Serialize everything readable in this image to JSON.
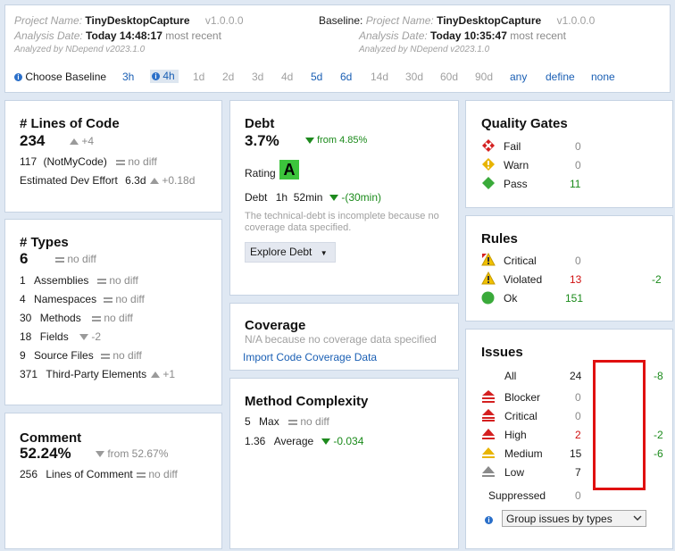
{
  "header": {
    "project_label": "Project Name:",
    "project_name": "TinyDesktopCapture",
    "version": "v1.0.0.0",
    "analysis_label": "Analysis Date:",
    "analysis_date": "Today 14:48:17",
    "most_recent": "most recent",
    "analyzed_by": "Analyzed by NDepend v2023.1.0",
    "baseline_label": "Baseline:",
    "baseline_project_label": "Project Name:",
    "baseline_project_name": "TinyDesktopCapture",
    "baseline_version": "v1.0.0.0",
    "baseline_analysis_label": "Analysis Date:",
    "baseline_analysis_date": "Today 10:35:47",
    "baseline_most_recent": "most recent",
    "baseline_analyzed_by": "Analyzed by NDepend v2023.1.0"
  },
  "baseline_bar": {
    "choose_label": "Choose Baseline",
    "options": [
      "3h",
      "4h",
      "1d",
      "2d",
      "3d",
      "4d",
      "5d",
      "6d",
      "14d",
      "30d",
      "60d",
      "90d",
      "any",
      "define",
      "none"
    ],
    "selected": "4h"
  },
  "loc": {
    "title": "# Lines of Code",
    "value": "234",
    "delta": "+4",
    "notmycode_value": "117",
    "notmycode_label": "(NotMyCode)",
    "notmycode_diff": "no diff",
    "effort_label": "Estimated Dev Effort",
    "effort_value": "6.3d",
    "effort_delta": "+0.18d"
  },
  "types": {
    "title": "# Types",
    "value": "6",
    "diff": "no diff",
    "rows": [
      {
        "value": "1",
        "label": "Assemblies",
        "diff": "no diff"
      },
      {
        "value": "4",
        "label": "Namespaces",
        "diff": "no diff"
      },
      {
        "value": "30",
        "label": "Methods",
        "diff": "no diff"
      },
      {
        "value": "18",
        "label": "Fields",
        "diff": "-2"
      },
      {
        "value": "9",
        "label": "Source Files",
        "diff": "no diff"
      },
      {
        "value": "371",
        "label": "Third-Party Elements",
        "diff": "+1"
      }
    ]
  },
  "comment": {
    "title": "Comment",
    "value": "52.24%",
    "from": "from 52.67%",
    "lines_value": "256",
    "lines_label": "Lines of Comment",
    "lines_diff": "no diff"
  },
  "debt": {
    "title": "Debt",
    "value": "3.7%",
    "from": "from 4.85%",
    "rating_label": "Rating",
    "rating": "A",
    "debt_label": "Debt",
    "debt_value": "1h  52min",
    "debt_delta": "-(30min)",
    "note": "The technical-debt is incomplete because no coverage data specified.",
    "explore_label": "Explore Debt"
  },
  "coverage": {
    "title": "Coverage",
    "note": "N/A because no coverage data specified",
    "import_label": "Import Code Coverage Data"
  },
  "complexity": {
    "title": "Method Complexity",
    "max_value": "5",
    "max_label": "Max",
    "max_diff": "no diff",
    "avg_value": "1.36",
    "avg_label": "Average",
    "avg_delta": "-0.034"
  },
  "quality_gates": {
    "title": "Quality Gates",
    "fail_label": "Fail",
    "fail_value": "0",
    "warn_label": "Warn",
    "warn_value": "0",
    "pass_label": "Pass",
    "pass_value": "11"
  },
  "rules": {
    "title": "Rules",
    "critical_label": "Critical",
    "critical_value": "0",
    "violated_label": "Violated",
    "violated_value": "13",
    "violated_delta": "-2",
    "ok_label": "Ok",
    "ok_value": "151"
  },
  "issues": {
    "title": "Issues",
    "all_label": "All",
    "all_value": "24",
    "all_delta": "-8",
    "blocker_label": "Blocker",
    "blocker_value": "0",
    "critical_label": "Critical",
    "critical_value": "0",
    "high_label": "High",
    "high_value": "2",
    "high_delta": "-2",
    "medium_label": "Medium",
    "medium_value": "15",
    "medium_delta": "-6",
    "low_label": "Low",
    "low_value": "7",
    "suppressed_label": "Suppressed",
    "suppressed_value": "0",
    "group_select": "Group issues by types"
  },
  "colors": {
    "accent": "#1a5fb4",
    "green": "#1a8a1a",
    "red": "#d01010",
    "highlight_box": "#e01010",
    "rating_bg": "#3cc43c"
  }
}
